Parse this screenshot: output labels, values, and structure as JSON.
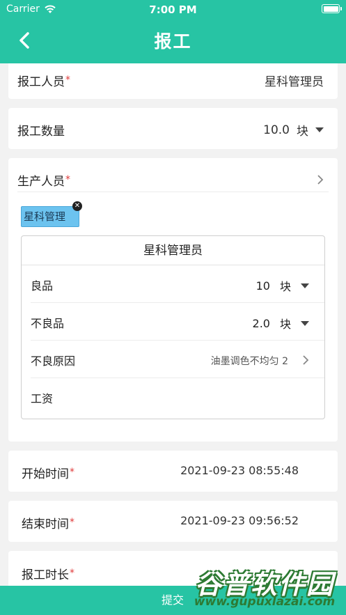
{
  "status_bar": {
    "carrier": "Carrier",
    "time": "7:00 PM"
  },
  "nav": {
    "title": "报工",
    "back_icon": "chevron-left-icon"
  },
  "form": {
    "reporter": {
      "label": "报工人员",
      "required_mark": "*",
      "value": "星科管理员"
    },
    "quantity": {
      "label": "报工数量",
      "value": "10.0",
      "unit": "块"
    },
    "producers": {
      "label": "生产人员",
      "required_mark": "*",
      "tags": [
        "星科管理"
      ],
      "detail": {
        "name": "星科管理员",
        "good": {
          "label": "良品",
          "value": "10",
          "unit": "块"
        },
        "defective": {
          "label": "不良品",
          "value": "2.0",
          "unit": "块"
        },
        "reason": {
          "label": "不良原因",
          "value": "油墨调色不均匀 2"
        },
        "wage": {
          "label": "工资",
          "value": ""
        }
      }
    },
    "start_time": {
      "label": "开始时间",
      "required_mark": "*",
      "value": "2021-09-23 08:55:48"
    },
    "end_time": {
      "label": "结束时间",
      "required_mark": "*",
      "value": "2021-09-23 09:56:52"
    },
    "duration": {
      "label": "报工时长",
      "required_mark": "*"
    }
  },
  "submit": {
    "label": "提交"
  },
  "watermark": {
    "text": "谷普软件园",
    "url": "www.gupuxlazai.com"
  },
  "colors": {
    "brand": "#27c4a4",
    "required": "#e03b3b",
    "tag": "#6cc3ef"
  }
}
